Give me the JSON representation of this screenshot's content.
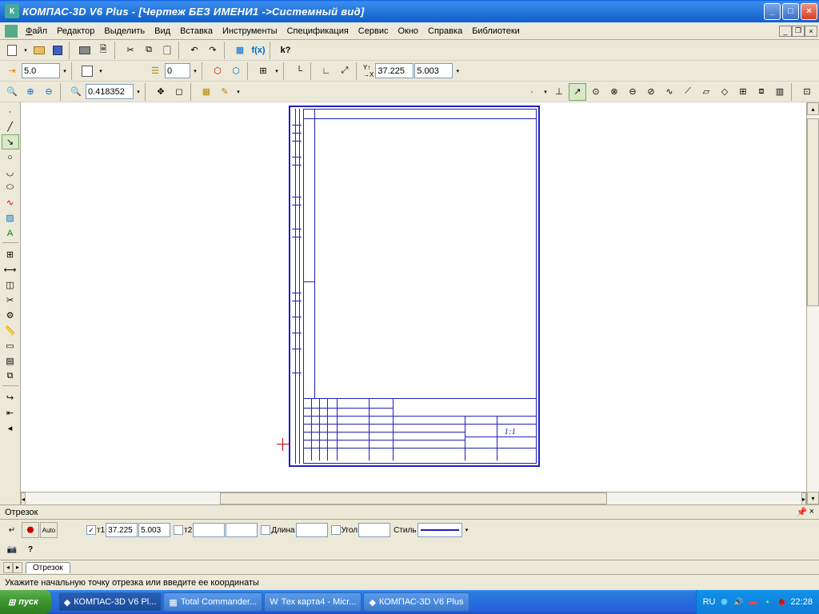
{
  "title": "КОМПАС-3D V6 Plus - [Чертеж БЕЗ ИМЕНИ1 ->Системный вид]",
  "menu": {
    "file": "Файл",
    "edit": "Редактор",
    "select": "Выделить",
    "view": "Вид",
    "insert": "Вставка",
    "tools": "Инструменты",
    "spec": "Спецификация",
    "service": "Сервис",
    "window": "Окно",
    "help": "Справка",
    "libs": "Библиотеки"
  },
  "toolbar2": {
    "step": "5.0",
    "layer": "0",
    "coordX": "37.225",
    "coordY": "5.003"
  },
  "toolbar3": {
    "zoom": "0.418352"
  },
  "panel": {
    "title": "Отрезок"
  },
  "props": {
    "t1": "т1",
    "x1": "37.225",
    "y1": "5.003",
    "t2": "т2",
    "x2": "",
    "y2": "",
    "lenLabel": "Длина",
    "len": "",
    "angLabel": "Угол",
    "ang": "",
    "styleLabel": "Стиль"
  },
  "tabs": {
    "cur": "Отрезок"
  },
  "status": "Укажите начальную точку отрезка или введите ее координаты",
  "taskbar": {
    "start": "пуск",
    "t1": "КОМПАС-3D V6 Pl...",
    "t2": "Total Commander...",
    "t3": "Тех карта4 - Micr...",
    "t4": "КОМПАС-3D V6 Plus",
    "lang": "RU",
    "time": "22:28"
  }
}
